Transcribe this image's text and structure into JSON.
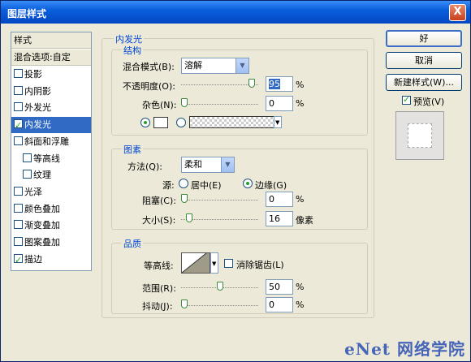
{
  "window": {
    "title": "图层样式",
    "close_glyph": "X"
  },
  "sidebar": {
    "header": "样式",
    "blending": "混合选项:自定",
    "items": [
      {
        "label": "投影",
        "checked": false
      },
      {
        "label": "内阴影",
        "checked": false
      },
      {
        "label": "外发光",
        "checked": false
      },
      {
        "label": "内发光",
        "checked": true,
        "selected": true
      },
      {
        "label": "斜面和浮雕",
        "checked": false
      },
      {
        "label": "等高线",
        "checked": false,
        "sub": true
      },
      {
        "label": "纹理",
        "checked": false,
        "sub": true
      },
      {
        "label": "光泽",
        "checked": false
      },
      {
        "label": "颜色叠加",
        "checked": false
      },
      {
        "label": "渐变叠加",
        "checked": false
      },
      {
        "label": "图案叠加",
        "checked": false
      },
      {
        "label": "描边",
        "checked": true
      }
    ]
  },
  "panel": {
    "title": "内发光",
    "structure": {
      "label": "结构",
      "blend_mode_label": "混合模式(B):",
      "blend_mode_value": "溶解",
      "opacity_label": "不透明度(O):",
      "opacity_value": "95",
      "opacity_unit": "%",
      "opacity_level": 0.95,
      "noise_label": "杂色(N):",
      "noise_value": "0",
      "noise_unit": "%",
      "noise_level": 0
    },
    "elements": {
      "label": "图素",
      "method_label": "方法(Q):",
      "method_value": "柔和",
      "source_label": "源:",
      "source_center": "居中(E)",
      "source_edge": "边缘(G)",
      "choke_label": "阻塞(C):",
      "choke_value": "0",
      "choke_unit": "%",
      "choke_level": 0,
      "size_label": "大小(S):",
      "size_value": "16",
      "size_unit": "像素",
      "size_level": 0.064
    },
    "quality": {
      "label": "品质",
      "contour_label": "等高线:",
      "antialias_label": "消除锯齿(L)",
      "range_label": "范围(R):",
      "range_value": "50",
      "range_unit": "%",
      "range_level": 0.5,
      "jitter_label": "抖动(J):",
      "jitter_value": "0",
      "jitter_unit": "%",
      "jitter_level": 0
    }
  },
  "buttons": {
    "ok": "好",
    "cancel": "取消",
    "new_style": "新建样式(W)...",
    "preview_label": "预览(V)"
  },
  "watermark": "eNet 网络学院"
}
